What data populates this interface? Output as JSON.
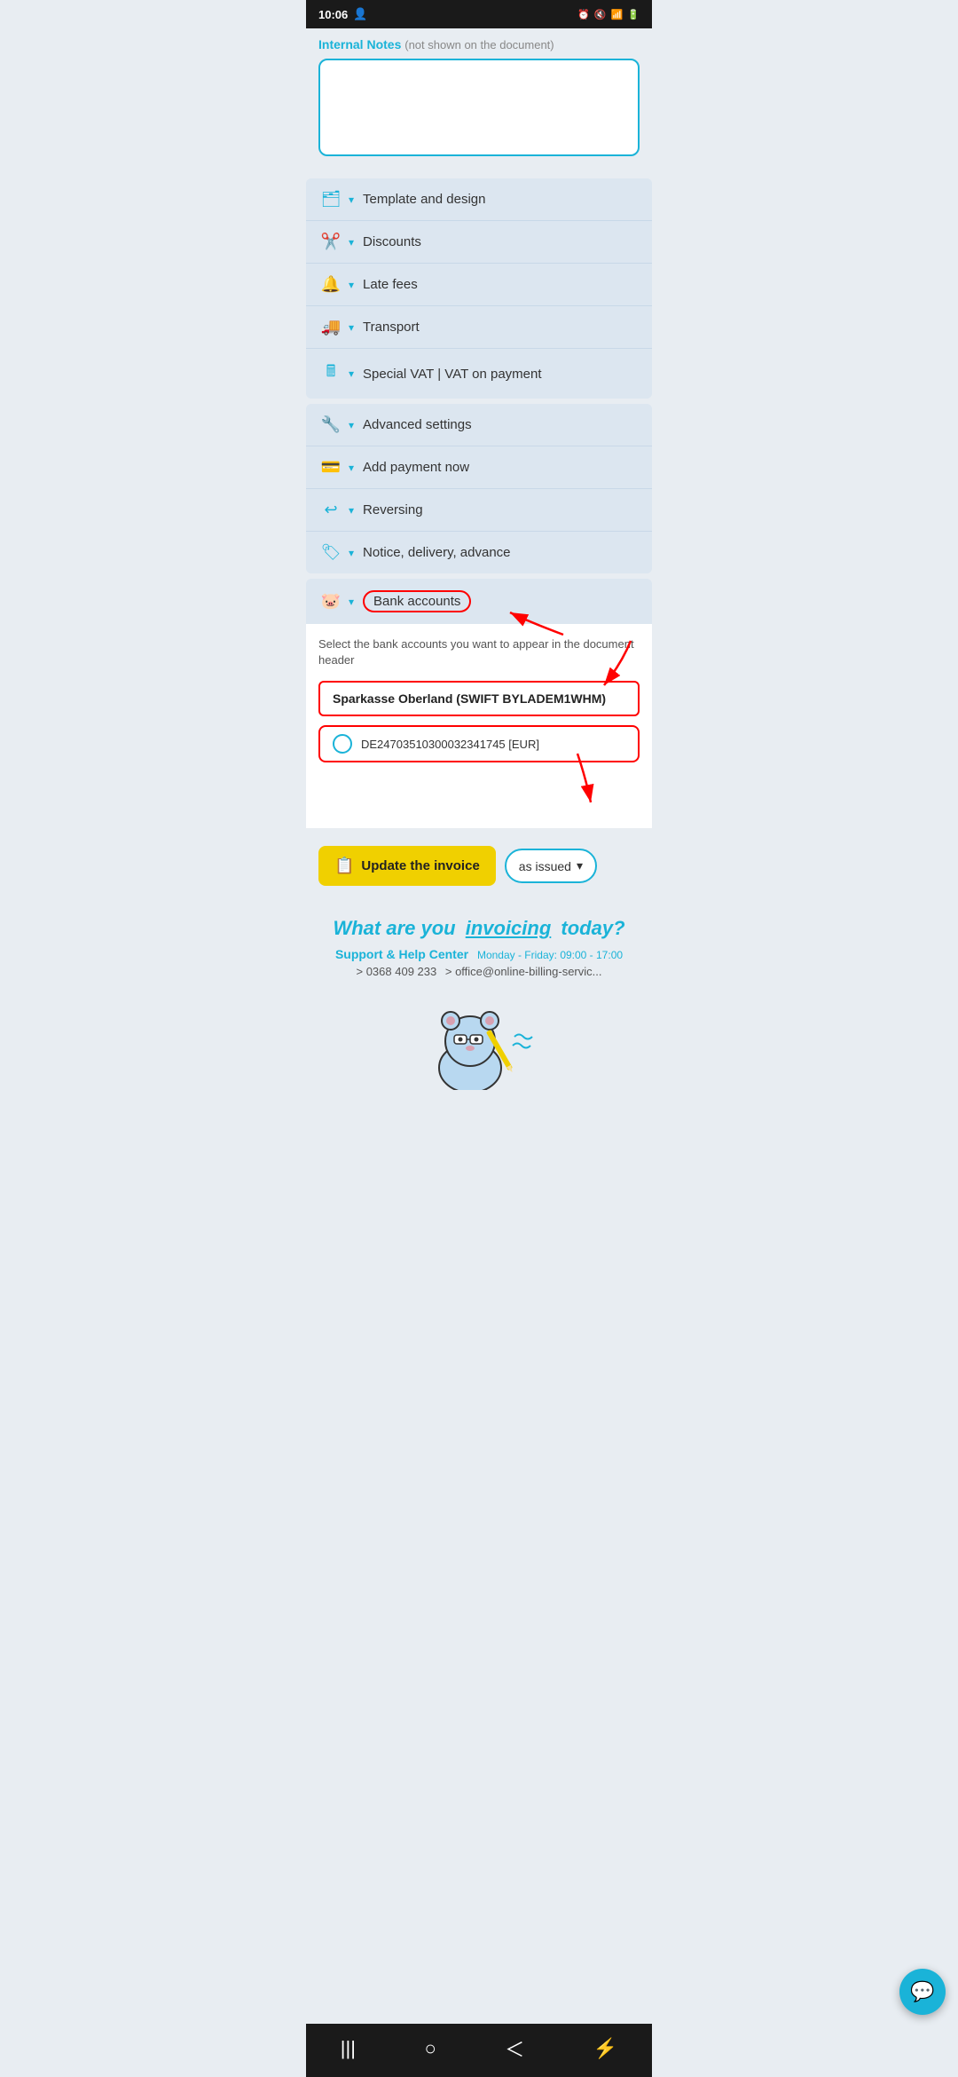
{
  "statusBar": {
    "time": "10:06",
    "icons": [
      "alarm",
      "mute",
      "signal",
      "battery"
    ]
  },
  "internalNotes": {
    "label": "Internal Notes",
    "notShown": "(not shown on the document)",
    "placeholder": ""
  },
  "accordionGroups": {
    "group1": [
      {
        "id": "template-design",
        "icon": "🗂",
        "label": "Template and design"
      },
      {
        "id": "discounts",
        "icon": "✂",
        "label": "Discounts"
      },
      {
        "id": "late-fees",
        "icon": "🔔",
        "label": "Late fees"
      },
      {
        "id": "transport",
        "icon": "🚚",
        "label": "Transport"
      },
      {
        "id": "special-vat",
        "icon": "🖩",
        "label": "Special VAT | VAT on payment"
      }
    ],
    "group2": [
      {
        "id": "advanced-settings",
        "icon": "🔧",
        "label": "Advanced settings"
      },
      {
        "id": "add-payment",
        "icon": "💳",
        "label": "Add payment now"
      },
      {
        "id": "reversing",
        "icon": "↩",
        "label": "Reversing"
      },
      {
        "id": "notice-delivery",
        "icon": "🏷",
        "label": "Notice, delivery, advance"
      }
    ]
  },
  "bankAccounts": {
    "label": "Bank accounts",
    "description": "Select the bank accounts you want to appear in the document header",
    "bankName": "Sparkasse Oberland (SWIFT BYLADEM1WHM)",
    "iban": "DE24703510300032341745 [EUR]"
  },
  "updateBar": {
    "buttonLabel": "Update the invoice",
    "dropdownLabel": "as issued",
    "dropdownIcon": "▾"
  },
  "footer": {
    "headline1": "What are you",
    "headline2": "invoicing",
    "headline3": "today?",
    "support": "Support & Help Center",
    "hours": "Monday - Friday: 09:00 - 17:00",
    "phone": "> 0368 409 233",
    "email": "> office@online-billing-servic..."
  },
  "navBar": {
    "items": [
      "|||",
      "○",
      "<",
      "⚡"
    ]
  }
}
